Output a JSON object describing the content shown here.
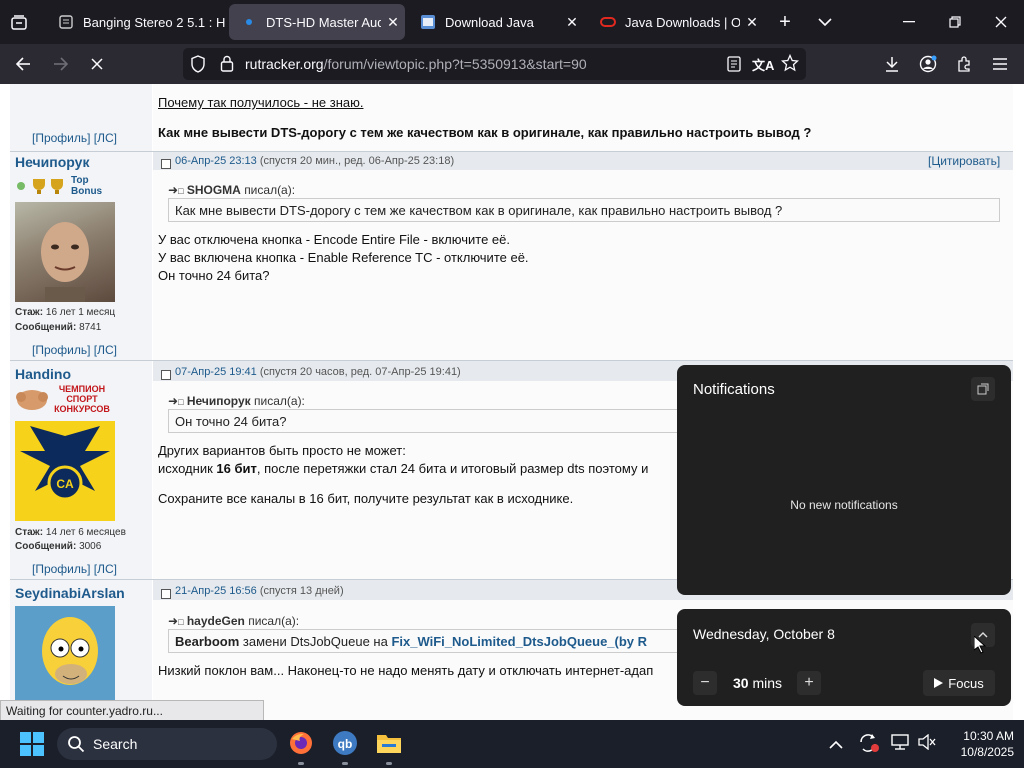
{
  "browser": {
    "tabs": [
      {
        "title": "Banging Stereo 2 5.1 : H",
        "active": false
      },
      {
        "title": "DTS-HD Master Audio",
        "active": true
      },
      {
        "title": "Download Java",
        "active": false
      },
      {
        "title": "Java Downloads | Oracl",
        "active": false
      }
    ],
    "url_host": "rutracker.org",
    "url_path": "/forum/viewtopic.php?t=5350913&start=90"
  },
  "page": {
    "top": {
      "line1": "Почему так получилось - не знаю.",
      "line2": "Как мне вывести DTS-дорогу с тем же качеством как в оригинале, как правильно настроить вывод ?",
      "profile_links": "[Профиль]  [ЛС]"
    },
    "posts": [
      {
        "nick": "Нечипорук",
        "badge": "Top Bonus",
        "stazh": "16 лет 1 месяц",
        "soobsh": "8741",
        "stazh_label": "Стаж:",
        "soobsh_label": "Сообщений:",
        "date": "06-Апр-25 23:13",
        "meta": "(спустя 20 мин., ред. 06-Апр-25 23:18)",
        "cite": "[Цитировать]",
        "quote_author": "SHOGMA",
        "quote_suffix": "писал(а):",
        "quote": "Как мне вывести DTS-дорогу с тем же качеством как в оригинале, как правильно настроить вывод ?",
        "lines": [
          "У вас отключена кнопка - Encode Entire File - включите её.",
          "У вас включена кнопка - Enable Reference TC - отключите её.",
          "Он точно 24 бита?"
        ],
        "profile_links": "[Профиль]  [ЛС]"
      },
      {
        "nick": "Handino",
        "badge": "ЧЕМПИОН СПОРТ КОНКУРСОВ",
        "stazh": "14 лет 6 месяцев",
        "soobsh": "3006",
        "stazh_label": "Стаж:",
        "soobsh_label": "Сообщений:",
        "date": "07-Апр-25 19:41",
        "meta": "(спустя 20 часов, ред. 07-Апр-25 19:41)",
        "quote_author": "Нечипорук",
        "quote_suffix": "писал(а):",
        "quote": "Он точно 24 бита?",
        "line1": "Других вариантов быть просто не может:",
        "line2_pre": "исходник ",
        "line2_bold": "16 бит",
        "line2_post": ", после перетяжки стал 24 бита и итоговый размер dts поэтому и",
        "line3": "Сохраните все каналы в 16 бит, получите результат как в исходнике.",
        "profile_links": "[Профиль]  [ЛС]"
      },
      {
        "nick": "SeydinabiArslan",
        "date": "21-Апр-25 16:56",
        "meta": "(спустя 13 дней)",
        "quote_author": "haydeGen",
        "quote_suffix": "писал(а):",
        "quote_bold": "Bearboom",
        "quote_mid": " замени DtsJobQueue на ",
        "quote_link": "Fix_WiFi_NoLimited_DtsJobQueue_(by R",
        "line1": "Низкий поклон вам... Наконец-то не надо менять дату и отключать интернет-адап"
      }
    ]
  },
  "status_text": "Waiting for counter.yadro.ru...",
  "notifications": {
    "title": "Notifications",
    "empty": "No new notifications"
  },
  "calendar": {
    "date": "Wednesday, October 8",
    "focus_minutes": "30",
    "focus_unit": "mins",
    "focus_label": "Focus"
  },
  "taskbar": {
    "search": "Search",
    "time": "10:30 AM",
    "date": "10/8/2025"
  }
}
